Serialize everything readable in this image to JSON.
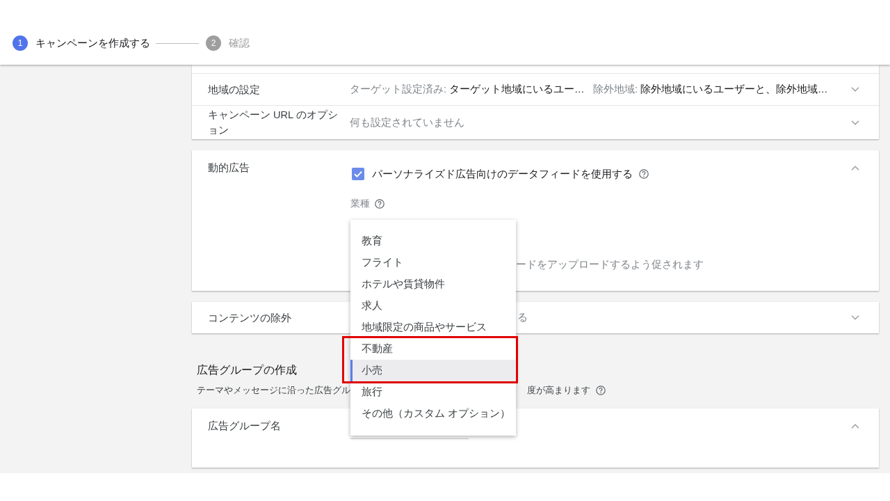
{
  "stepper": {
    "steps": [
      {
        "number": "1",
        "label": "キャンペーンを作成する",
        "selected": true
      },
      {
        "number": "2",
        "label": "確認",
        "selected": false
      }
    ]
  },
  "settings": {
    "rows": [
      {
        "label": "地域の設定",
        "expanded": false,
        "summaries": [
          {
            "parts": [
              {
                "text": "ターゲット設定済み:",
                "muted": true
              },
              {
                "text": "ターゲット地域にいるユー…",
                "muted": false
              }
            ]
          },
          {
            "parts": [
              {
                "text": "除外地域:",
                "muted": true
              },
              {
                "text": "除外地域にいるユーザーと、除外地域…",
                "muted": false
              }
            ]
          }
        ]
      },
      {
        "label": "キャンペーン URL のオプション",
        "expanded": false,
        "summaries": [
          {
            "parts": [
              {
                "text": "何も設定されていません",
                "muted": true
              }
            ]
          }
        ]
      }
    ]
  },
  "dynamic_ads": {
    "label": "動的広告",
    "expanded": true,
    "checkbox": {
      "label": "パーソナライズド広告向けのデータフィードを使用する",
      "checked": true
    },
    "industry": {
      "label": "業種",
      "options": [
        {
          "label": "教育",
          "selected": false,
          "outlined": false
        },
        {
          "label": "フライト",
          "selected": false,
          "outlined": false
        },
        {
          "label": "ホテルや賃貸物件",
          "selected": false,
          "outlined": false
        },
        {
          "label": "求人",
          "selected": false,
          "outlined": false
        },
        {
          "label": "地域限定の商品やサービス",
          "selected": false,
          "outlined": false
        },
        {
          "label": "不動産",
          "selected": false,
          "outlined": true
        },
        {
          "label": "小売",
          "selected": true,
          "outlined": true
        },
        {
          "label": "旅行",
          "selected": false,
          "outlined": false
        },
        {
          "label": "その他（カスタム オプション）",
          "selected": false,
          "outlined": false
        }
      ],
      "hint": "ードをアップロードするよう促されます"
    }
  },
  "content_exclusion": {
    "label": "コンテンツの除外",
    "expanded": false,
    "summary": "る"
  },
  "ad_group": {
    "title": "広告グループの作成",
    "description": "テーマやメッセージに沿った広告グル",
    "description_tail": "度が高まります",
    "name_panel": {
      "label": "広告グループ名",
      "expanded": true
    }
  }
}
